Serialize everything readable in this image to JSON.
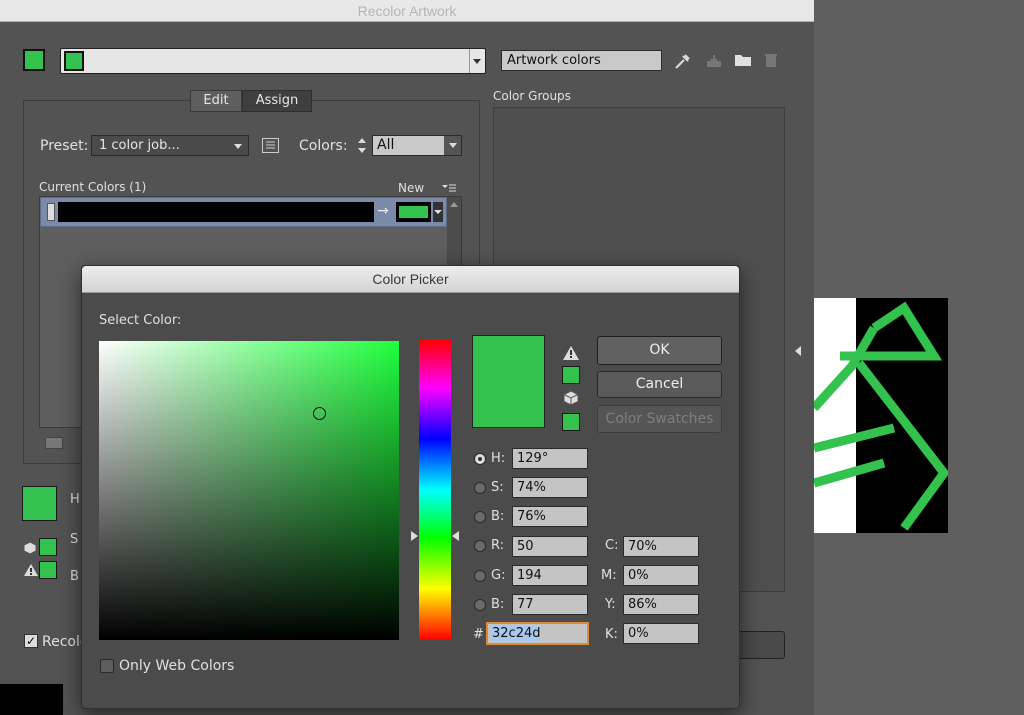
{
  "recolor": {
    "title": "Recolor Artwork",
    "artwork_colors": "Artwork colors",
    "color_groups": "Color Groups",
    "tab_edit": "Edit",
    "tab_assign": "Assign",
    "preset_label": "Preset:",
    "preset_value": "1 color job...",
    "colors_label": "Colors:",
    "colors_value": "All",
    "current_colors": "Current Colors (1)",
    "new_label": "New",
    "h_label": "H",
    "s_label": "S",
    "b_label": "B",
    "recolor_art": "Recolo"
  },
  "picker": {
    "title": "Color Picker",
    "select_color": "Select Color:",
    "ok": "OK",
    "cancel": "Cancel",
    "color_swatches": "Color Swatches",
    "only_web": "Only Web Colors",
    "h_label": "H:",
    "h_value": "129°",
    "s_label": "S:",
    "s_value": "74%",
    "b_label": "B:",
    "b_value": "76%",
    "r_label": "R:",
    "r_value": "50",
    "g_label": "G:",
    "g_value": "194",
    "bl_label": "B:",
    "bl_value": "77",
    "hash": "#",
    "hex_value": "32c24d",
    "c_label": "C:",
    "c_value": "70%",
    "m_label": "M:",
    "m_value": "0%",
    "y_label": "Y:",
    "y_value": "86%",
    "k_label": "K:",
    "k_value": "0%"
  },
  "colors": {
    "selected": "#32c24d",
    "panel": "#535353",
    "dialog": "#4d4d4d"
  }
}
